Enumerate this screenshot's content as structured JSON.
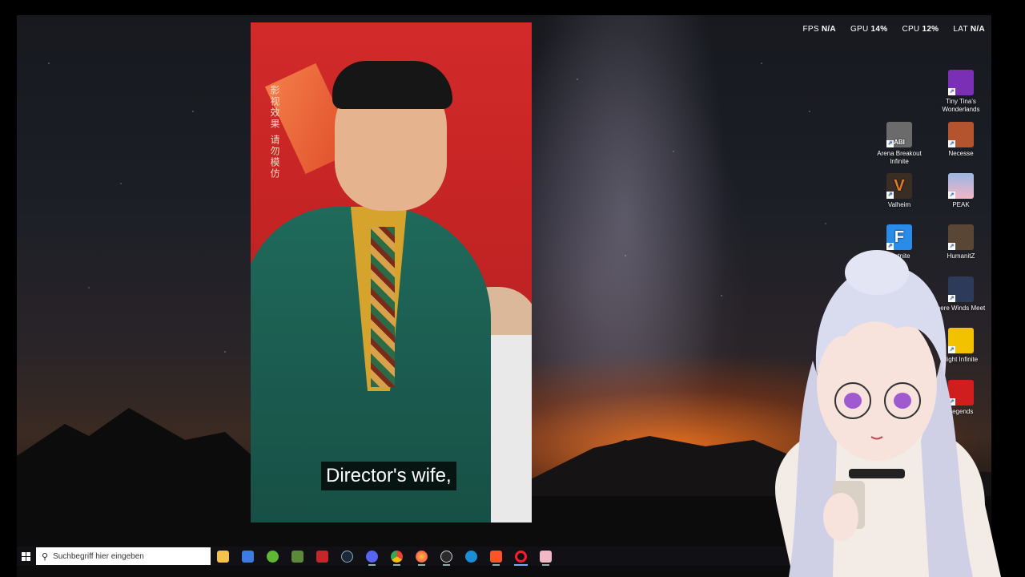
{
  "overlay_stats": [
    {
      "label": "FPS",
      "value": "N/A"
    },
    {
      "label": "GPU",
      "value": "14%"
    },
    {
      "label": "CPU",
      "value": "12%"
    },
    {
      "label": "LAT",
      "value": "N/A"
    }
  ],
  "video": {
    "subtitle": "Director's wife,",
    "calligraphy": "影视效果 请勿模仿"
  },
  "desktop_icons": [
    {
      "label": "Tiny Tina's Wonderlands",
      "icon": "tiny-tinas-wonderlands-icon",
      "color": "#7b2fb5"
    },
    {
      "label": "Arena Breakout Infinite",
      "icon": "arena-breakout-icon",
      "color": "#6b6b6b",
      "badge": "ABI"
    },
    {
      "label": "Necesse",
      "icon": "necesse-icon",
      "color": "#b3542f"
    },
    {
      "label": "Valheim",
      "icon": "valheim-icon",
      "color": "#3a2d24",
      "badge": "V"
    },
    {
      "label": "PEAK",
      "icon": "peak-icon",
      "color": "#9bb6e0"
    },
    {
      "label": "Fortnite",
      "icon": "fortnite-icon",
      "color": "#2a8be8",
      "badge": "F"
    },
    {
      "label": "HumanitZ",
      "icon": "humanitz-icon",
      "color": "#5a4634"
    },
    {
      "label": "here Winds Meet",
      "icon": "where-winds-meet-icon",
      "color": "#2d3a5a"
    },
    {
      "label": "llight Infinite",
      "icon": "skylight-infinite-icon",
      "color": "#f2c200"
    },
    {
      "label": "Legends",
      "icon": "apex-legends-icon",
      "color": "#d01e1e"
    }
  ],
  "taskbar": {
    "search_placeholder": "Suchbegriff hier eingeben",
    "apps": [
      {
        "name": "file-explorer-icon",
        "color": "#f2c14e"
      },
      {
        "name": "microsoft-store-icon",
        "color": "#3d7be0"
      },
      {
        "name": "xbox-icon",
        "color": "#5fb833"
      },
      {
        "name": "minecraft-icon",
        "color": "#5a8a3a"
      },
      {
        "name": "mrbeast-icon",
        "color": "#c2282a"
      },
      {
        "name": "steam-icon",
        "color": "#1b2838"
      },
      {
        "name": "discord-icon",
        "color": "#5865f2"
      },
      {
        "name": "chrome-icon",
        "color": "#e0a82e"
      },
      {
        "name": "firefox-icon",
        "color": "#ff7139"
      },
      {
        "name": "obs-icon",
        "color": "#2b2b2b"
      },
      {
        "name": "battle-net-icon",
        "color": "#1a8fd6"
      },
      {
        "name": "brave-icon",
        "color": "#fb542b"
      },
      {
        "name": "opera-icon",
        "color": "#ff1b2d"
      },
      {
        "name": "vtube-studio-icon",
        "color": "#f2b8c6"
      }
    ]
  }
}
